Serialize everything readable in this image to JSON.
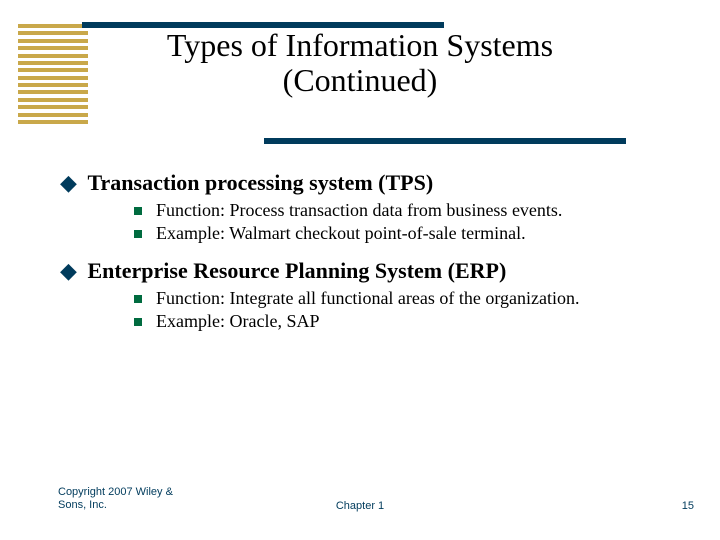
{
  "title_line1": "Types of Information Systems",
  "title_line2": "(Continued)",
  "items": [
    {
      "heading": "Transaction processing system (TPS)",
      "subs": [
        "Function:  Process transaction data from business events.",
        "Example:  Walmart checkout point-of-sale terminal."
      ]
    },
    {
      "heading": "Enterprise Resource Planning System (ERP)",
      "subs": [
        "Function:  Integrate all functional areas of the organization.",
        "Example:  Oracle, SAP"
      ]
    }
  ],
  "footer_left": "Copyright 2007 Wiley & Sons, Inc.",
  "footer_center": "Chapter 1",
  "footer_right": "15"
}
